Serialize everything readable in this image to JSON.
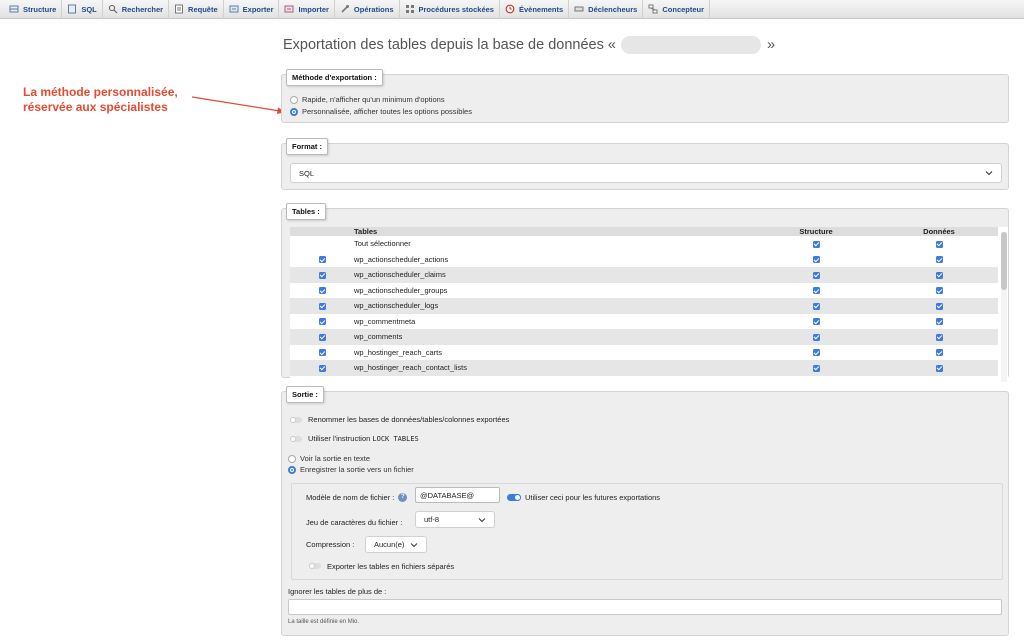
{
  "tabs": [
    {
      "label": "Structure",
      "icon": "structure-icon"
    },
    {
      "label": "SQL",
      "icon": "sql-icon"
    },
    {
      "label": "Rechercher",
      "icon": "search-icon"
    },
    {
      "label": "Requête",
      "icon": "query-icon"
    },
    {
      "label": "Exporter",
      "icon": "export-icon"
    },
    {
      "label": "Importer",
      "icon": "import-icon"
    },
    {
      "label": "Opérations",
      "icon": "wrench-icon"
    },
    {
      "label": "Procédures stockées",
      "icon": "routines-icon"
    },
    {
      "label": "Évènements",
      "icon": "clock-icon"
    },
    {
      "label": "Déclencheurs",
      "icon": "triggers-icon"
    },
    {
      "label": "Concepteur",
      "icon": "designer-icon"
    }
  ],
  "page": {
    "title_prefix": "Exportation des tables depuis la base de données «",
    "title_suffix": "»"
  },
  "annotation": {
    "line1": "La méthode personnalisée,",
    "line2": "réservée aux spécialistes",
    "color": "#e44b32"
  },
  "method": {
    "legend": "Méthode d'exportation :",
    "options": [
      {
        "label": "Rapide, n'afficher qu'un minimum d'options",
        "selected": false
      },
      {
        "label": "Personnalisée, afficher toutes les options possibles",
        "selected": true
      }
    ]
  },
  "format": {
    "legend": "Format :",
    "selected": "SQL"
  },
  "tables": {
    "legend": "Tables :",
    "headers": {
      "name": "Tables",
      "structure": "Structure",
      "data": "Données"
    },
    "select_all_label": "Tout sélectionner",
    "rows": [
      "wp_actionscheduler_actions",
      "wp_actionscheduler_claims",
      "wp_actionscheduler_groups",
      "wp_actionscheduler_logs",
      "wp_commentmeta",
      "wp_comments",
      "wp_hostinger_reach_carts",
      "wp_hostinger_reach_contact_lists"
    ]
  },
  "output": {
    "legend": "Sortie :",
    "rename_label": "Renommer les bases de données/tables/colonnes exportées",
    "lock_label_prefix": "Utiliser l'instruction",
    "lock_label_code": "LOCK TABLES",
    "view_text_label": "Voir la sortie en texte",
    "save_file_label": "Enregistrer la sortie vers un fichier",
    "filename_label": "Modèle de nom de fichier :",
    "filename_value": "@DATABASE@",
    "future_exports_label": "Utiliser ceci pour les futures exportations",
    "charset_label": "Jeu de caractères du fichier :",
    "charset_value": "utf-8",
    "compression_label": "Compression :",
    "compression_value": "Aucun(e)",
    "separate_files_label": "Exporter les tables en fichiers séparés",
    "skip_tables_label": "Ignorer les tables de plus de :",
    "size_note": "La taille est définie en Mio."
  },
  "colors": {
    "accent": "#3d7be0",
    "link": "#234a88"
  }
}
